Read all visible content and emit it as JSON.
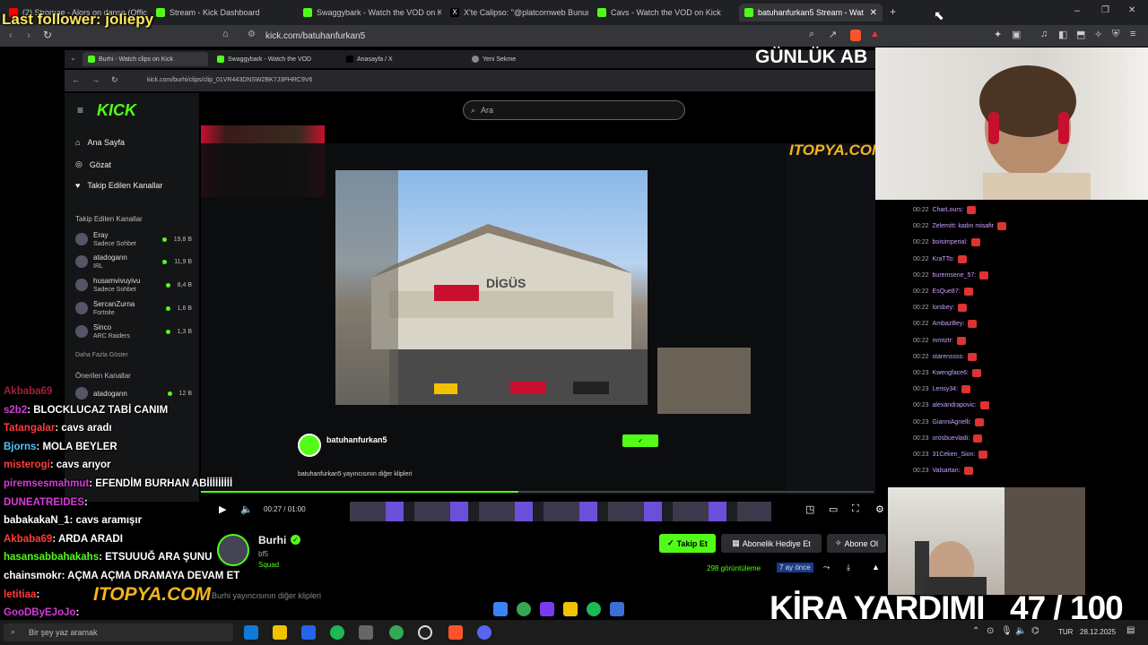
{
  "overlay": {
    "last_follower": "Last follower: joliepy",
    "kira_label": "KİRA YARDIMI",
    "kira_progress": "47 / 100",
    "itopya": "ITOPYA.COM",
    "gunluk": "GÜNLÜK AB"
  },
  "outer_tabs": [
    {
      "label": "(2) Stromae - Alors on danse (Official",
      "color": "#ff0000"
    },
    {
      "label": "Stream - Kick Dashboard",
      "color": "#53fc18"
    },
    {
      "label": "Swaggybark - Watch the VOD on Kick",
      "color": "#53fc18"
    },
    {
      "label": "X'te Calipso: \"@platcornweb Bunun i",
      "color": "#ffffff"
    },
    {
      "label": "Cavs - Watch the VOD on Kick",
      "color": "#53fc18"
    },
    {
      "label": "batuhanfurkan5 Stream - Wat",
      "color": "#53fc18"
    }
  ],
  "outer_url": "kick.com/batuhanfurkan5",
  "inner_tabs": [
    "Burhi - Watch clips on Kick",
    "Swaggybark - Watch the VOD",
    "Anasayfa / X",
    "Yeni Sekme"
  ],
  "inner_url": "kick.com/burhi/clips/clip_01VR443DNSW2BK7J3PHRC9V6",
  "kick": {
    "logo": "KICK",
    "search_placeholder": "Ara",
    "nav": [
      "Ana Sayfa",
      "Gözat",
      "Takip Edilen Kanallar"
    ],
    "followed_title": "Takip Edilen Kanallar",
    "followed": [
      {
        "name": "Eray",
        "sub": "Sadece Sohbet",
        "count": "19,8 B"
      },
      {
        "name": "atadogann",
        "sub": "IRL",
        "count": "11,9 B"
      },
      {
        "name": "husamvivuyivu",
        "sub": "Sadece Sohbet",
        "count": "8,4 B"
      },
      {
        "name": "SercanZurna",
        "sub": "Fortnite",
        "count": "1,6 B"
      },
      {
        "name": "Sinco",
        "sub": "ARC Raiders",
        "count": "1,3 B"
      }
    ],
    "more": "Daha Fazla Göster",
    "recommended_title": "Önerilen Kanallar",
    "recommended": [
      {
        "name": "atadogann",
        "count": "12 B"
      }
    ],
    "channel": {
      "name": "Burhi",
      "sub": "bf5",
      "role": "Squad",
      "follow_btn": "Takip Et",
      "gift_btn": "Abonelik Hediye Et",
      "sub_btn": "Abone Ol",
      "views": "298 görüntüleme",
      "ago": "7 ay önce",
      "clips_text": "Burhi yayıncısının diğer klipleri"
    },
    "clip_streamer": "batuhanfurkan5",
    "clip_streamer_clips": "batuhanfurkan5 yayıncısının diğer klipleri",
    "time": "00:27 / 01:00"
  },
  "chat": [
    {
      "user": "Akbaba69",
      "msg": "",
      "color": "#a0203a"
    },
    {
      "user": "s2b2",
      "msg": ": BLOCKLUCAZ TABİ CANIM",
      "color": "#d63bd9"
    },
    {
      "user": "Tatangalar",
      "msg": ": cavs aradı",
      "color": "#ff3b3b"
    },
    {
      "user": "Bjorns",
      "msg": ": MOLA BEYLER",
      "color": "#4fc3ff"
    },
    {
      "user": "misterogi",
      "msg": ": cavs arıyor",
      "color": "#ff3b3b"
    },
    {
      "user": "piremsesmahmut",
      "msg": ": EFENDİM BURHAN ABİİİİİİİİİ",
      "color": "#d63bd9"
    },
    {
      "user": "DUNEATREIDES",
      "msg": ":",
      "color": "#d63bd9"
    },
    {
      "user": "babakakaN_1",
      "msg": ": cavs aramışır",
      "color": "#ffffff"
    },
    {
      "user": "Akbaba69",
      "msg": ": ARDA ARADI",
      "color": "#ff3b3b"
    },
    {
      "user": "hasansabbahakahs",
      "msg": ": ETSUUUĞ ARA ŞUNU",
      "color": "#53fc18"
    },
    {
      "user": "chainsmokr",
      "msg": ": AÇMA AÇMA DRAMAYA DEVAM ET",
      "color": "#ffffff"
    },
    {
      "user": "letitiaa",
      "msg": ":",
      "color": "#ff3b3b"
    },
    {
      "user": "GooDByEJoJo",
      "msg": ":",
      "color": "#d63bd9"
    }
  ],
  "right_chat": [
    {
      "t": "00:22",
      "u": "CharLours:"
    },
    {
      "t": "00:22",
      "u": "Zelemitt: kadın misafir"
    },
    {
      "t": "00:22",
      "u": "boisimperial:"
    },
    {
      "t": "00:22",
      "u": "KraTTo:"
    },
    {
      "t": "00:22",
      "u": "buremsene_57:"
    },
    {
      "t": "00:22",
      "u": "EsQue87:"
    },
    {
      "t": "00:22",
      "u": "lorsbey:"
    },
    {
      "t": "00:22",
      "u": "AmbazBey:"
    },
    {
      "t": "00:22",
      "u": "mmtztr:"
    },
    {
      "t": "00:22",
      "u": "starenssss:"
    },
    {
      "t": "00:23",
      "u": "Kwengface6:"
    },
    {
      "t": "00:23",
      "u": "Lensy34:"
    },
    {
      "t": "00:23",
      "u": "alexandrapovic:"
    },
    {
      "t": "00:23",
      "u": "GianniAgnelli:"
    },
    {
      "t": "00:23",
      "u": "orosbuevladi:"
    },
    {
      "t": "00:23",
      "u": "31Ceken_Sion:"
    },
    {
      "t": "00:23",
      "u": "Valsartan:"
    }
  ],
  "taskbar": {
    "search": "Bir şey yaz aramak",
    "lang": "TUR",
    "date": "28.12.2025"
  },
  "stadium_sign": "DİGÜS"
}
